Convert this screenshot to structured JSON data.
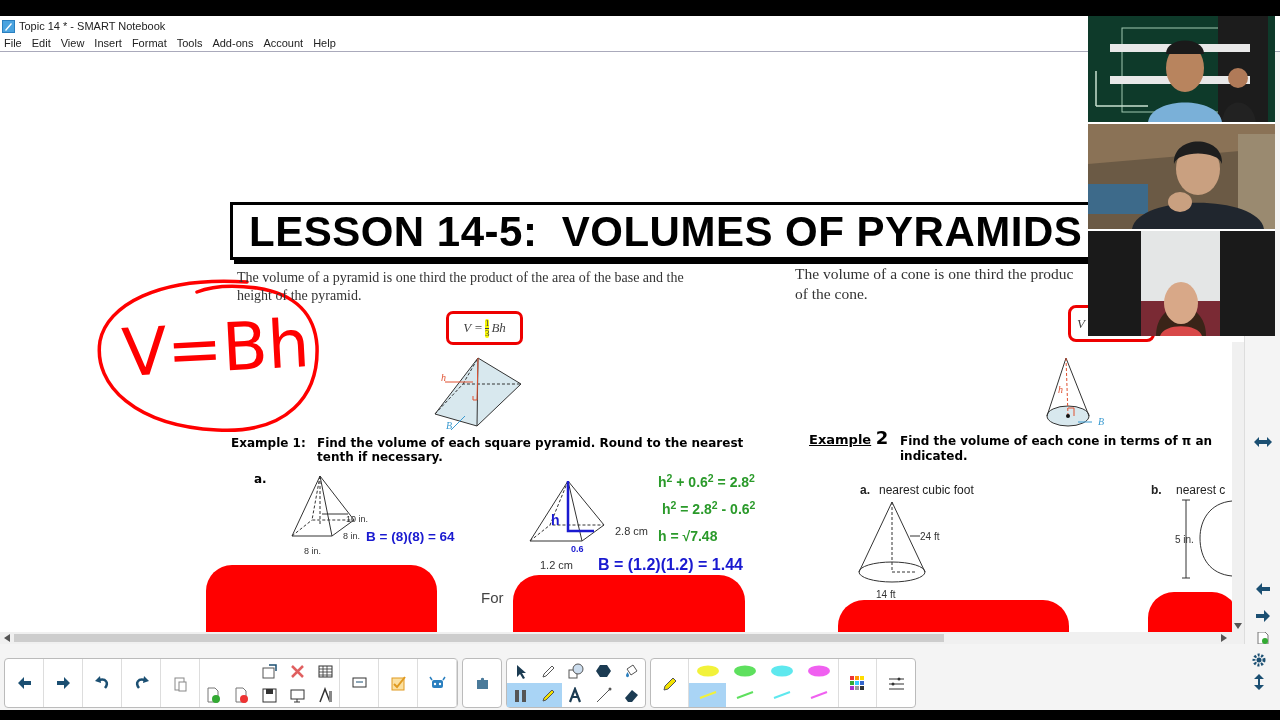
{
  "window": {
    "title": "Topic 14 * - SMART Notebook"
  },
  "menu": [
    "File",
    "Edit",
    "View",
    "Insert",
    "Format",
    "Tools",
    "Add-ons",
    "Account",
    "Help"
  ],
  "page": {
    "heading": "LESSON 14-5:  VOLUMES OF PYRAMIDS",
    "handwriting": "V=Bh",
    "pyramid_text": "The volume of a pyramid is one third the product of the area of the base and the height of the pyramid.",
    "pyramid_formula": {
      "lhs": "V =",
      "numerator": "1",
      "denominator": "3",
      "rhs": "Bh",
      "highlighted": true
    },
    "pyramid_labels": {
      "height": "h",
      "base": "B"
    },
    "cone_text": [
      "The volume of a cone is one third the produc",
      "of the cone."
    ],
    "cone_formula": "V",
    "cone_labels": {
      "height": "h",
      "base": "B"
    },
    "example1": {
      "label": "Example 1:",
      "text": "Find the volume of each square pyramid. Round to the nearest tenth if necessary.",
      "item_a": {
        "letter": "a.",
        "slant": "10 in.",
        "depth": "8 in.",
        "width": "8 in.",
        "work": "B =  (8)(8) = 64"
      },
      "item_b": {
        "slant": "2.8 cm",
        "width": "1.2 cm",
        "height": "h",
        "half": "0.6",
        "steps": [
          "h$^{2}$ + 0.6$^{2}$ = 2.8$^{2}$",
          "h$^{2}$ = 2.8$^{2}$ - 0.6$^{2}$",
          "h = √7.48"
        ],
        "work": "B =  (1.2)(1.2) = 1.44"
      },
      "partial": "For"
    },
    "example2": {
      "label": "Example",
      "number": "2",
      "text": "Find the volume of each cone in terms of π an",
      "text_2": "indicated.",
      "item_a": {
        "letter": "a.",
        "prompt": "nearest cubic foot",
        "slant": "24 ft",
        "diameter": "14 ft"
      },
      "item_b": {
        "letter": "b.",
        "prompt": "nearest c",
        "height": "5 in."
      }
    }
  },
  "video_tiles": [
    {
      "kind": "picture"
    },
    {
      "kind": "picture"
    },
    {
      "kind": "picture"
    }
  ],
  "toolbar": {
    "pen_tools": [
      {
        "selected": false
      },
      {
        "selected": false
      },
      {
        "selected": false
      },
      {
        "selected": false
      },
      {
        "selected": false
      },
      {
        "selected": true
      },
      {
        "selected": true
      },
      {
        "selected": false
      },
      {
        "selected": false
      },
      {
        "selected": false
      }
    ],
    "pen_styles": [
      {
        "selected": false
      },
      {
        "selected": false
      },
      {
        "selected": false
      },
      {
        "selected": false
      },
      {
        "selected": true
      },
      {
        "selected": false
      },
      {
        "selected": false
      },
      {
        "selected": false
      }
    ]
  }
}
